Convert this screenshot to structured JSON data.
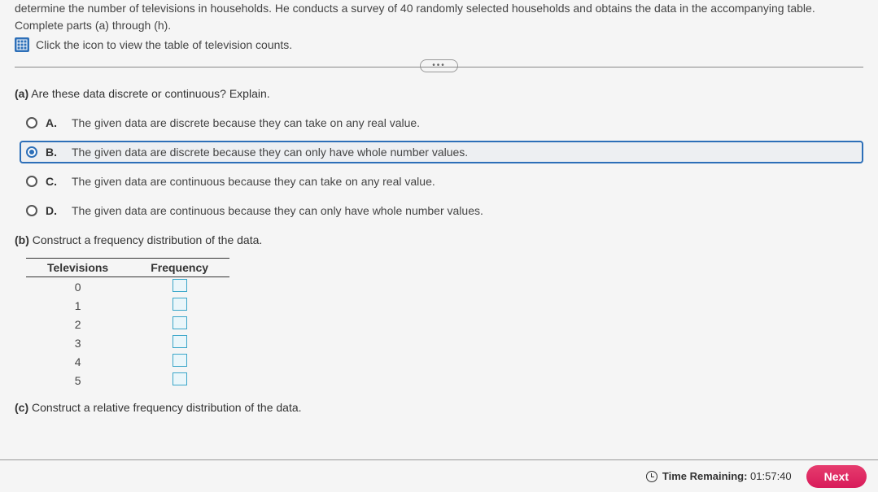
{
  "intro": {
    "line1_fragment": "determine the number of televisions in households. He conducts a survey of 40 randomly selected households and obtains the data in the accompanying table. Complete parts (a) through (h).",
    "icon_link_text": "Click the icon to view the table of television counts."
  },
  "part_a": {
    "prompt_prefix": "(a)",
    "prompt_text": " Are these data discrete or continuous? Explain.",
    "choices": [
      {
        "letter": "A.",
        "text": "The given data are discrete because they can take on any real value.",
        "selected": false
      },
      {
        "letter": "B.",
        "text": "The given data are discrete because they can only have whole number values.",
        "selected": true
      },
      {
        "letter": "C.",
        "text": "The given data are continuous because they can take on any real value.",
        "selected": false
      },
      {
        "letter": "D.",
        "text": "The given data are continuous because they can only have whole number values.",
        "selected": false
      }
    ]
  },
  "part_b": {
    "prompt_prefix": "(b)",
    "prompt_text": " Construct a frequency distribution of the data.",
    "headers": {
      "col1": "Televisions",
      "col2": "Frequency"
    },
    "rows": [
      {
        "tv": "0"
      },
      {
        "tv": "1"
      },
      {
        "tv": "2"
      },
      {
        "tv": "3"
      },
      {
        "tv": "4"
      },
      {
        "tv": "5"
      }
    ]
  },
  "part_c": {
    "prompt_prefix": "(c)",
    "prompt_text": " Construct a relative frequency distribution of the data."
  },
  "footer": {
    "time_label": "Time Remaining:",
    "time_value": " 01:57:40",
    "next_label": "Next"
  }
}
